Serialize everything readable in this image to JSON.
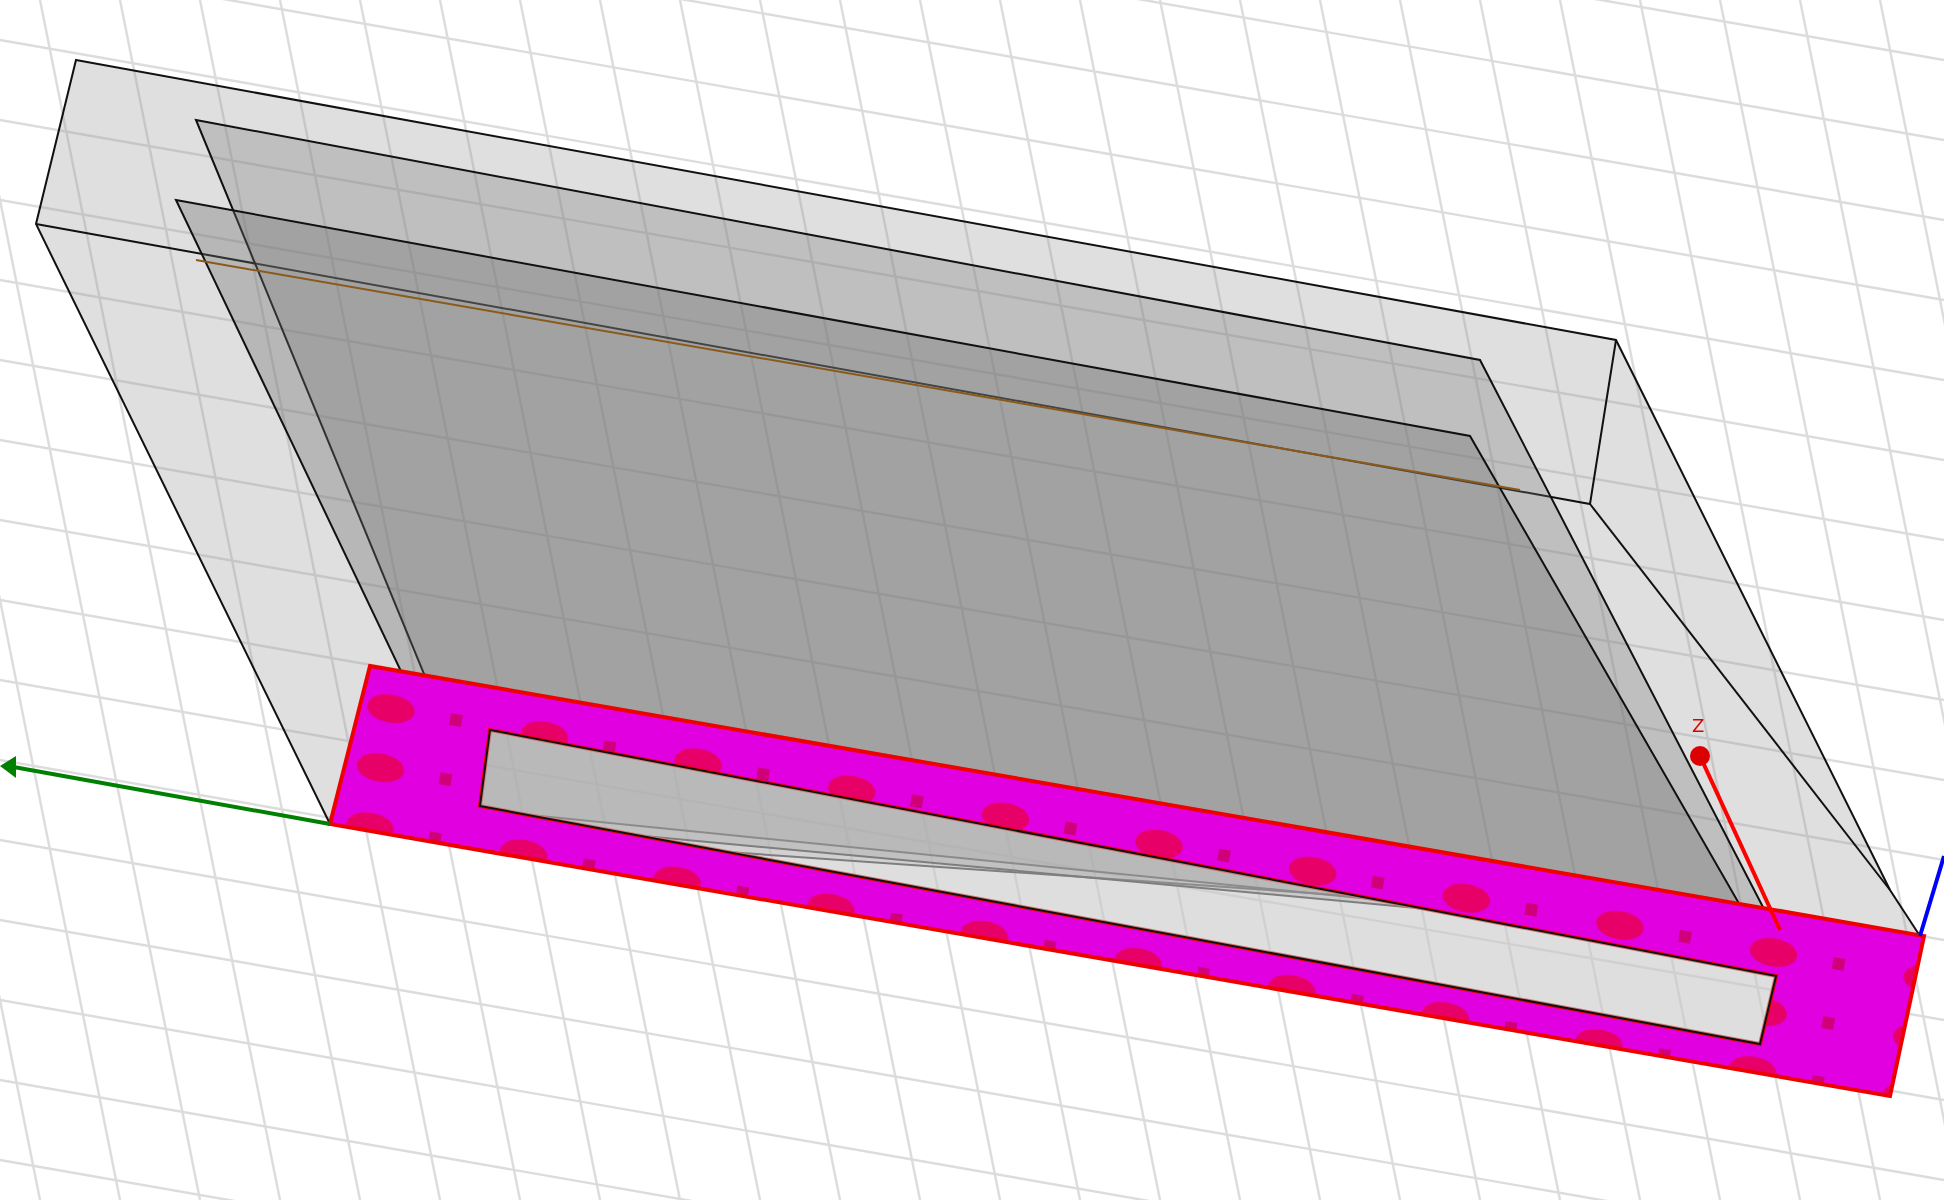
{
  "viewport": {
    "z_axis_label": "Z"
  }
}
